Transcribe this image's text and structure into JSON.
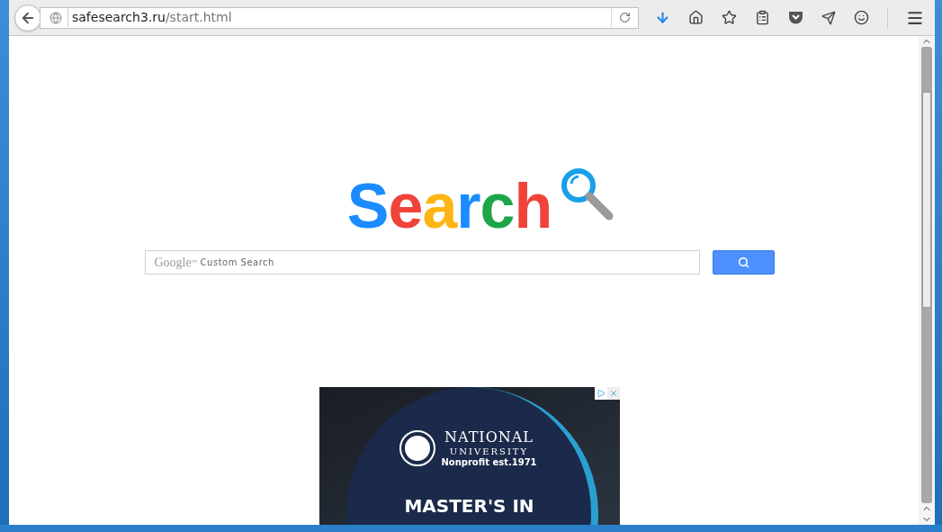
{
  "toolbar": {
    "url_host": "safesearch3.ru",
    "url_path": "/start.html"
  },
  "logo": {
    "letters": [
      {
        "char": "S",
        "color": "#1a8cff"
      },
      {
        "char": "e",
        "color": "#f0433a"
      },
      {
        "char": "a",
        "color": "#fdb515"
      },
      {
        "char": "r",
        "color": "#1a8cff"
      },
      {
        "char": "c",
        "color": "#1da548"
      },
      {
        "char": "h",
        "color": "#f0433a"
      }
    ]
  },
  "search": {
    "brand": "Google",
    "tm": "™",
    "placeholder": "Custom Search"
  },
  "ad": {
    "title": "NATIONAL",
    "subtitle": "UNIVERSITY",
    "tagline": "Nonprofit est.1971",
    "headline": "MASTER'S IN"
  }
}
